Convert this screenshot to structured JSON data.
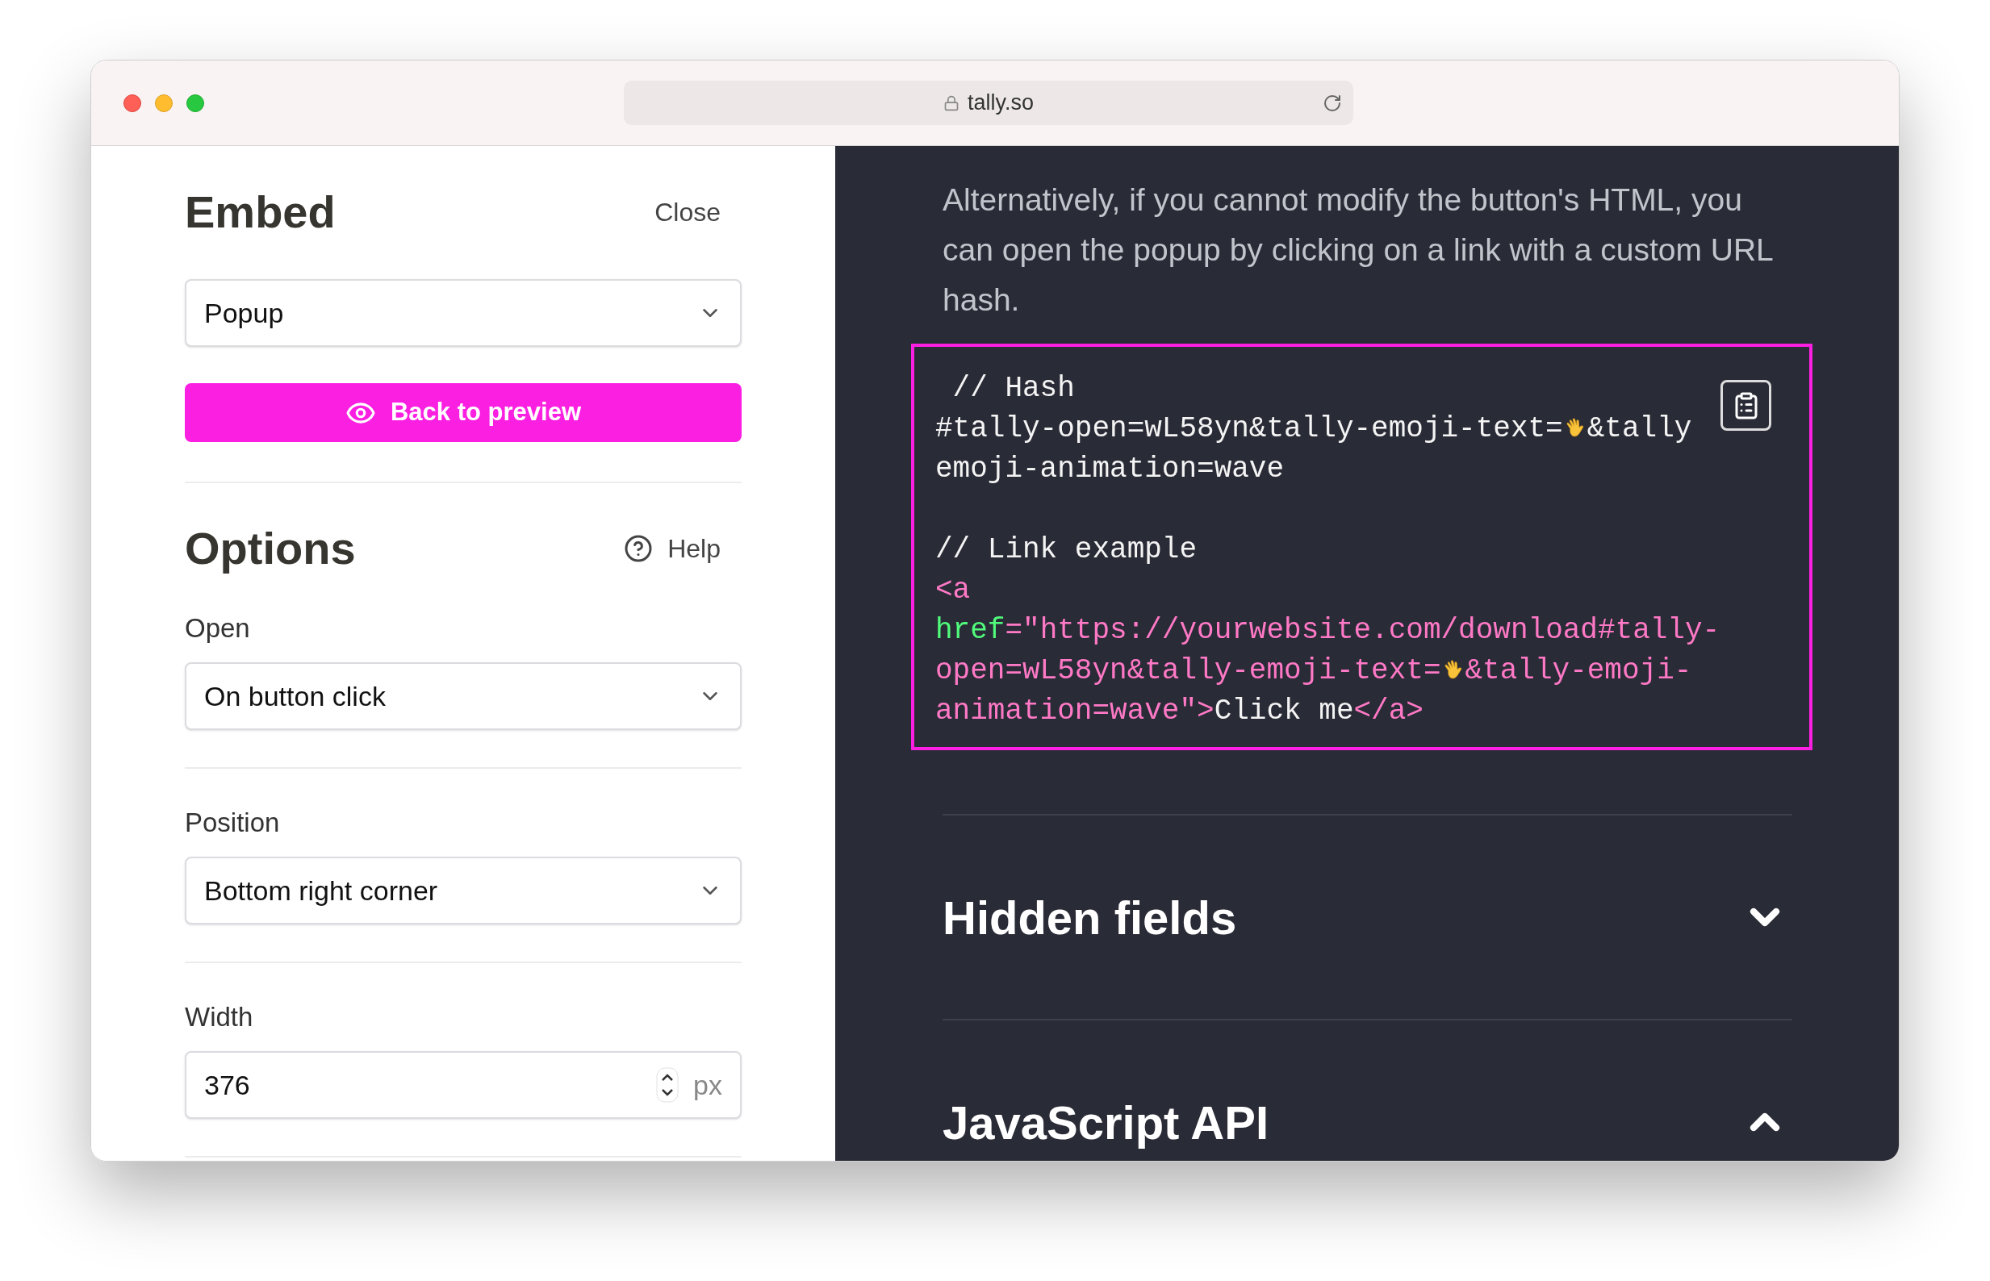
{
  "browser": {
    "url": "tally.so"
  },
  "embed": {
    "title": "Embed",
    "close": "Close",
    "embed_type": "Popup",
    "preview_button": "Back to preview"
  },
  "options": {
    "title": "Options",
    "help": "Help",
    "fields": [
      {
        "kind": "select",
        "label": "Open",
        "value": "On button click"
      },
      {
        "kind": "select",
        "label": "Position",
        "value": "Bottom right corner"
      },
      {
        "kind": "number",
        "label": "Width",
        "value": "376",
        "unit": "px"
      }
    ]
  },
  "docs": {
    "paragraph": "Alternatively, if you cannot modify the button's HTML, you can open the popup by clicking on a link with a custom URL hash.",
    "code": {
      "lines": [
        {
          "kind": "code",
          "tokens": [
            {
              "kind": "plain",
              "text": " // Hash"
            }
          ]
        },
        {
          "kind": "code",
          "tokens": [
            {
              "kind": "plain",
              "text": "#tally-open=wL58yn&tally-emoji-text="
            },
            {
              "kind": "emoji"
            },
            {
              "kind": "plain",
              "text": "&tally"
            }
          ]
        },
        {
          "kind": "code",
          "tokens": [
            {
              "kind": "plain",
              "text": "emoji-animation=wave"
            }
          ]
        },
        {
          "kind": "blank"
        },
        {
          "kind": "code",
          "tokens": [
            {
              "kind": "plain",
              "text": "// Link example"
            }
          ]
        },
        {
          "kind": "code",
          "tokens": [
            {
              "kind": "tag",
              "text": "<a"
            }
          ]
        },
        {
          "kind": "code",
          "tokens": [
            {
              "kind": "attr",
              "text": "href"
            },
            {
              "kind": "tag",
              "text": "=\"https://yourwebsite.com/download#tally-"
            }
          ]
        },
        {
          "kind": "code",
          "tokens": [
            {
              "kind": "tag",
              "text": "open=wL58yn&tally-emoji-text="
            },
            {
              "kind": "emoji"
            },
            {
              "kind": "tag",
              "text": "&tally-emoji-"
            }
          ]
        },
        {
          "kind": "code",
          "tokens": [
            {
              "kind": "tag",
              "text": "animation=wave\">"
            },
            {
              "kind": "plain",
              "text": "Click me"
            },
            {
              "kind": "tag",
              "text": "</a>"
            }
          ]
        }
      ]
    },
    "sections": [
      {
        "title": "Hidden fields",
        "expanded": false
      },
      {
        "title": "JavaScript API",
        "expanded": true
      }
    ]
  }
}
